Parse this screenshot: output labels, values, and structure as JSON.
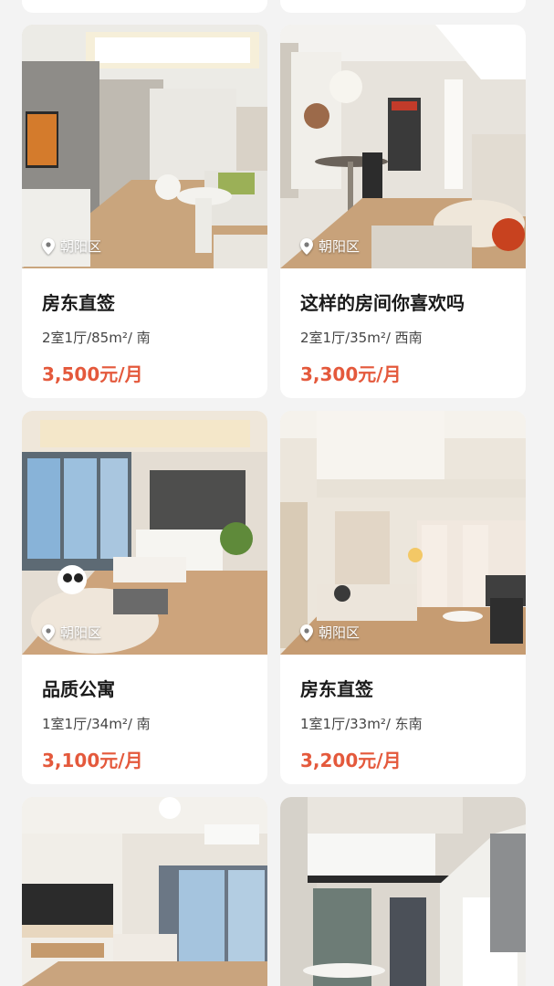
{
  "listings": [
    {
      "district": "朝阳区",
      "title": "房东直签",
      "specs": "2室1厅/85m²/ 南",
      "price": "3,500元/月"
    },
    {
      "district": "朝阳区",
      "title": "这样的房间你喜欢吗",
      "specs": "2室1厅/35m²/ 西南",
      "price": "3,300元/月"
    },
    {
      "district": "朝阳区",
      "title": "品质公寓",
      "specs": "1室1厅/34m²/ 南",
      "price": "3,100元/月"
    },
    {
      "district": "朝阳区",
      "title": "房东直签",
      "specs": "1室1厅/33m²/ 东南",
      "price": "3,200元/月"
    }
  ],
  "colors": {
    "price": "#e4593c",
    "background": "#f3f3f3",
    "card": "#ffffff"
  },
  "icons": {
    "location": "location-pin-icon"
  }
}
